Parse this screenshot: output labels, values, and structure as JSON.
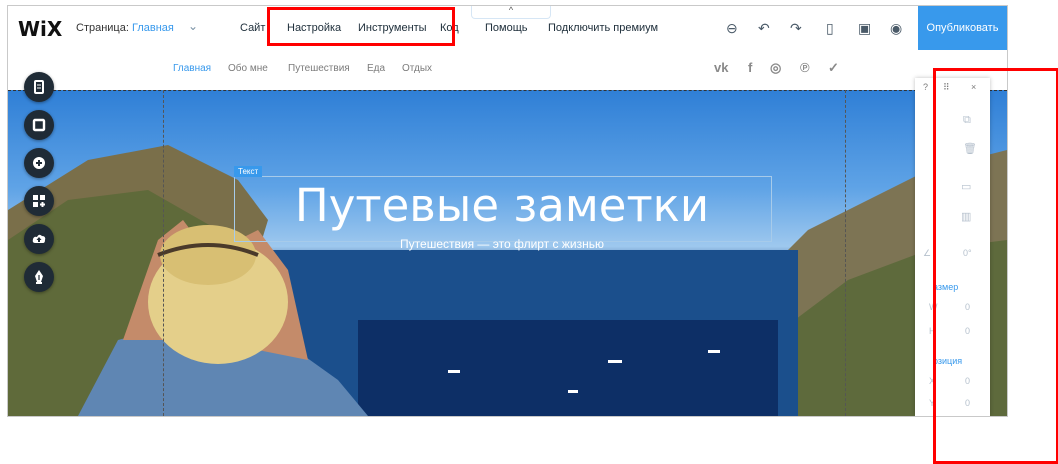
{
  "editor": {
    "logo": "WiX",
    "page_label": "Страница:",
    "page_value": "Главная",
    "menu": [
      "Сайт",
      "Настройка",
      "Инструменты",
      "Код",
      "Помощь",
      "Подключить премиум"
    ],
    "publish": "Опубликовать",
    "handle": "^"
  },
  "site_nav": {
    "links": [
      "Главная",
      "Обо мне",
      "Путешествия",
      "Еда",
      "Отдых"
    ],
    "active": "Главная",
    "social": [
      "vk",
      "f",
      "ig",
      "p",
      "tw"
    ]
  },
  "hero": {
    "tag": "Текст",
    "title": "Путевые заметки",
    "subtitle": "Путешествия — это флирт с жизнью"
  },
  "panel": {
    "help": "?",
    "close": "×",
    "angle_symbol": "∠",
    "angle_value": "0°",
    "size_label": "азмер",
    "w_label": "W",
    "w_value": "0",
    "h_label": "H",
    "h_value": "0",
    "position_label": "озиция",
    "x_label": "X",
    "x_value": "0",
    "y_label": "Y",
    "y_value": "0"
  },
  "colors": {
    "accent": "#3899ec",
    "highlight": "#ff0000",
    "toolbar_dark": "#1f2b36"
  }
}
